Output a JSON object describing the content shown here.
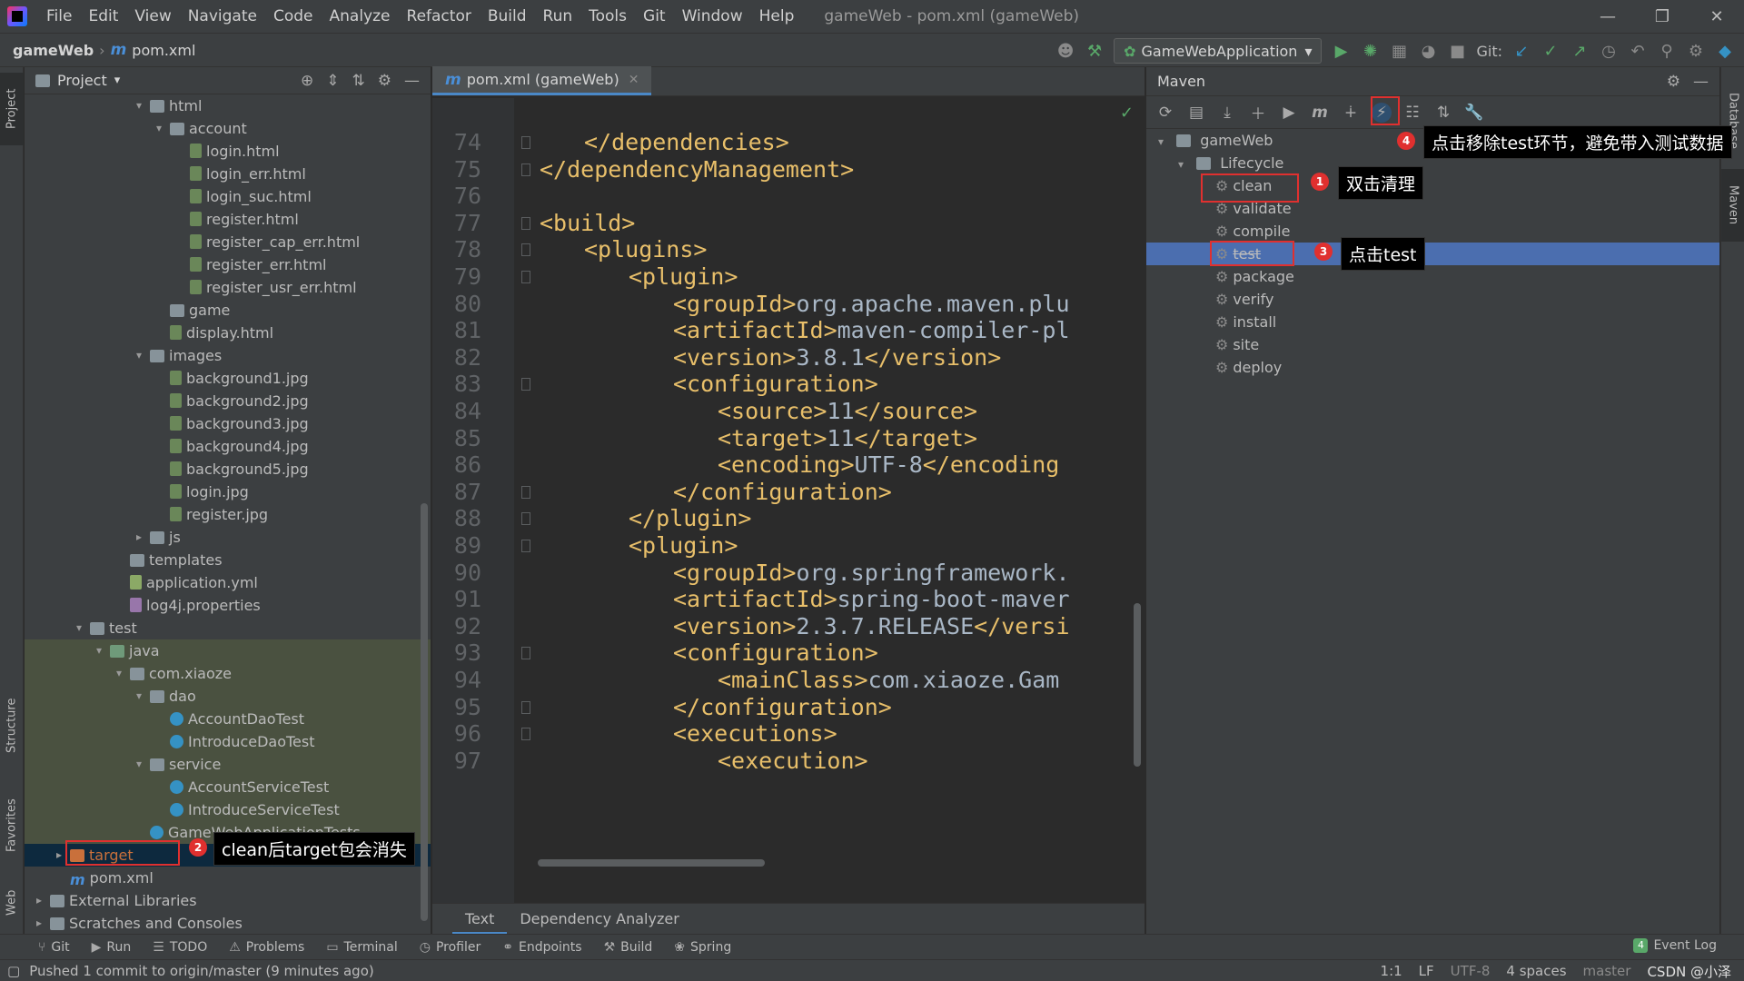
{
  "menubar": {
    "items": [
      "File",
      "Edit",
      "View",
      "Navigate",
      "Code",
      "Analyze",
      "Refactor",
      "Build",
      "Run",
      "Tools",
      "Git",
      "Window",
      "Help"
    ],
    "title": "gameWeb - pom.xml (gameWeb)"
  },
  "navbar": {
    "project": "gameWeb",
    "file": "pom.xml",
    "run_config": "GameWebApplication",
    "git_label": "Git:"
  },
  "left_strip": {
    "project": "Project",
    "structure": "Structure",
    "favorites": "Favorites",
    "web": "Web"
  },
  "project_panel": {
    "title": "Project",
    "tree": [
      {
        "label": "html",
        "level": 5,
        "icon": "folder",
        "arrow": "down"
      },
      {
        "label": "account",
        "level": 6,
        "icon": "folder",
        "arrow": "down"
      },
      {
        "label": "login.html",
        "level": 7,
        "icon": "file"
      },
      {
        "label": "login_err.html",
        "level": 7,
        "icon": "file"
      },
      {
        "label": "login_suc.html",
        "level": 7,
        "icon": "file"
      },
      {
        "label": "register.html",
        "level": 7,
        "icon": "file"
      },
      {
        "label": "register_cap_err.html",
        "level": 7,
        "icon": "file"
      },
      {
        "label": "register_err.html",
        "level": 7,
        "icon": "file"
      },
      {
        "label": "register_usr_err.html",
        "level": 7,
        "icon": "file"
      },
      {
        "label": "game",
        "level": 6,
        "icon": "folder"
      },
      {
        "label": "display.html",
        "level": 6,
        "icon": "file"
      },
      {
        "label": "images",
        "level": 5,
        "icon": "folder",
        "arrow": "down"
      },
      {
        "label": "background1.jpg",
        "level": 6,
        "icon": "file"
      },
      {
        "label": "background2.jpg",
        "level": 6,
        "icon": "file"
      },
      {
        "label": "background3.jpg",
        "level": 6,
        "icon": "file"
      },
      {
        "label": "background4.jpg",
        "level": 6,
        "icon": "file"
      },
      {
        "label": "background5.jpg",
        "level": 6,
        "icon": "file"
      },
      {
        "label": "login.jpg",
        "level": 6,
        "icon": "file"
      },
      {
        "label": "register.jpg",
        "level": 6,
        "icon": "file"
      },
      {
        "label": "js",
        "level": 5,
        "icon": "folder",
        "arrow": "right"
      },
      {
        "label": "templates",
        "level": 4,
        "icon": "folder"
      },
      {
        "label": "application.yml",
        "level": 4,
        "icon": "yml"
      },
      {
        "label": "log4j.properties",
        "level": 4,
        "icon": "props"
      },
      {
        "label": "test",
        "level": 2,
        "icon": "folder",
        "arrow": "down"
      },
      {
        "label": "java",
        "level": 3,
        "icon": "folder-test",
        "arrow": "down",
        "test": true
      },
      {
        "label": "com.xiaoze",
        "level": 4,
        "icon": "folder",
        "arrow": "down",
        "test": true
      },
      {
        "label": "dao",
        "level": 5,
        "icon": "folder",
        "arrow": "down",
        "test": true
      },
      {
        "label": "AccountDaoTest",
        "level": 6,
        "icon": "class",
        "test": true
      },
      {
        "label": "IntroduceDaoTest",
        "level": 6,
        "icon": "class",
        "test": true
      },
      {
        "label": "service",
        "level": 5,
        "icon": "folder",
        "arrow": "down",
        "test": true
      },
      {
        "label": "AccountServiceTest",
        "level": 6,
        "icon": "class",
        "test": true
      },
      {
        "label": "IntroduceServiceTest",
        "level": 6,
        "icon": "class",
        "test": true
      },
      {
        "label": "GameWebApplicationTests",
        "level": 5,
        "icon": "class",
        "test": true
      },
      {
        "label": "target",
        "level": 1,
        "icon": "folder-red",
        "arrow": "right",
        "selected": true
      },
      {
        "label": "pom.xml",
        "level": 1,
        "icon": "m"
      },
      {
        "label": "External Libraries",
        "level": 0,
        "icon": "folder",
        "arrow": "right"
      },
      {
        "label": "Scratches and Consoles",
        "level": 0,
        "icon": "folder",
        "arrow": "right"
      }
    ]
  },
  "editor": {
    "tab": "pom.xml (gameWeb)",
    "lines": [
      {
        "no": "74",
        "indent": 2,
        "text": "</dependencies>",
        "fold": true
      },
      {
        "no": "75",
        "indent": 0,
        "text": "</dependencyManagement>",
        "fold": true
      },
      {
        "no": "76",
        "indent": 0,
        "text": ""
      },
      {
        "no": "77",
        "indent": 0,
        "text": "<build>",
        "fold": true
      },
      {
        "no": "78",
        "indent": 2,
        "text": "<plugins>",
        "fold": true
      },
      {
        "no": "79",
        "indent": 4,
        "text": "<plugin>",
        "fold": true
      },
      {
        "no": "80",
        "indent": 6,
        "tag1": "<groupId>",
        "value": "org.apache.maven.plu",
        "tag2": ""
      },
      {
        "no": "81",
        "indent": 6,
        "tag1": "<artifactId>",
        "value": "maven-compiler-pl",
        "tag2": ""
      },
      {
        "no": "82",
        "indent": 6,
        "tag1": "<version>",
        "value": "3.8.1",
        "tag2": "</version>"
      },
      {
        "no": "83",
        "indent": 6,
        "text": "<configuration>",
        "fold": true
      },
      {
        "no": "84",
        "indent": 8,
        "tag1": "<source>",
        "value": "11",
        "tag2": "</source>"
      },
      {
        "no": "85",
        "indent": 8,
        "tag1": "<target>",
        "value": "11",
        "tag2": "</target>"
      },
      {
        "no": "86",
        "indent": 8,
        "tag1": "<encoding>",
        "value": "UTF-8",
        "tag2": "</encoding"
      },
      {
        "no": "87",
        "indent": 6,
        "text": "</configuration>",
        "fold": true
      },
      {
        "no": "88",
        "indent": 4,
        "text": "</plugin>",
        "fold": true
      },
      {
        "no": "89",
        "indent": 4,
        "text": "<plugin>",
        "fold": true
      },
      {
        "no": "90",
        "indent": 6,
        "tag1": "<groupId>",
        "value": "org.springframework.",
        "tag2": ""
      },
      {
        "no": "91",
        "indent": 6,
        "tag1": "<artifactId>",
        "value": "spring-boot-maver",
        "tag2": ""
      },
      {
        "no": "92",
        "indent": 6,
        "tag1": "<version>",
        "value": "2.3.7.RELEASE",
        "tag2": "</versi"
      },
      {
        "no": "93",
        "indent": 6,
        "text": "<configuration>",
        "fold": true
      },
      {
        "no": "94",
        "indent": 8,
        "tag1": "<mainClass>",
        "value": "com.xiaoze.Gam",
        "tag2": ""
      },
      {
        "no": "95",
        "indent": 6,
        "text": "</configuration>",
        "fold": true
      },
      {
        "no": "96",
        "indent": 6,
        "text": "<executions>",
        "fold": true
      },
      {
        "no": "97",
        "indent": 8,
        "text": "<execution>"
      }
    ],
    "bottom_tabs": [
      "Text",
      "Dependency Analyzer"
    ]
  },
  "maven": {
    "title": "Maven",
    "root": "gameWeb",
    "lifecycle": "Lifecycle",
    "goals": [
      "clean",
      "validate",
      "compile",
      "test",
      "package",
      "verify",
      "install",
      "site",
      "deploy"
    ],
    "selected_goal": "test"
  },
  "right_strip": {
    "database": "Database",
    "maven": "Maven"
  },
  "annotations": {
    "clean": "双击清理",
    "target": "clean后target包会消失",
    "test": "点击test",
    "skip": "点击移除test环节，避免带入测试数据",
    "n1": "1",
    "n2": "2",
    "n3": "3",
    "n4": "4"
  },
  "toolwindows": [
    "Git",
    "Run",
    "TODO",
    "Problems",
    "Terminal",
    "Profiler",
    "Endpoints",
    "Build",
    "Spring"
  ],
  "event_log": {
    "count": "4",
    "label": "Event Log"
  },
  "status": {
    "message": "Pushed 1 commit to origin/master (9 minutes ago)",
    "position": "1:1",
    "line_sep": "LF",
    "encoding": "UTF-8",
    "indent": "4 spaces",
    "branch": "master",
    "watermark": "CSDN @小泽"
  }
}
